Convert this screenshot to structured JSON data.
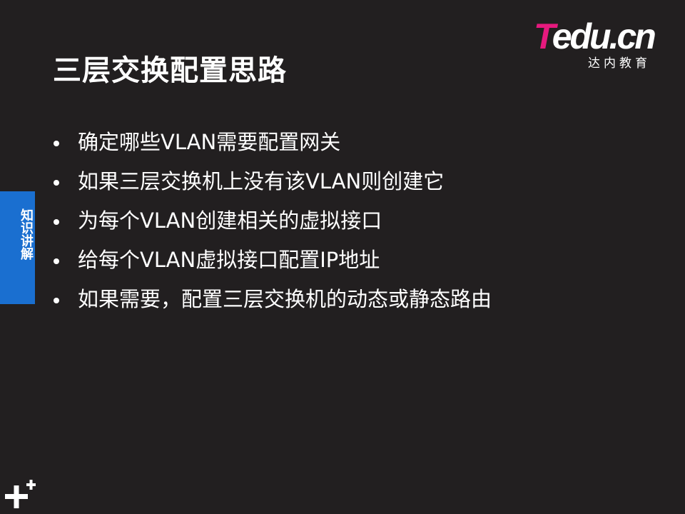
{
  "slide": {
    "title": "三层交换配置思路",
    "logo": {
      "word_first": "T",
      "word_rest": "edu.cn",
      "subtitle": "达内教育"
    },
    "side_tab": {
      "label": "知识讲解"
    },
    "bullets": [
      "确定哪些VLAN需要配置网关",
      "如果三层交换机上没有该VLAN则创建它",
      "为每个VLAN创建相关的虚拟接口",
      "给每个VLAN虚拟接口配置IP地址",
      "如果需要，配置三层交换机的动态或静态路由"
    ]
  },
  "colors": {
    "background": "#221f20",
    "accent_pink": "#e6197e",
    "tab_blue": "#1a6fd0",
    "text": "#ffffff"
  },
  "icons": [
    "plus-icon"
  ]
}
